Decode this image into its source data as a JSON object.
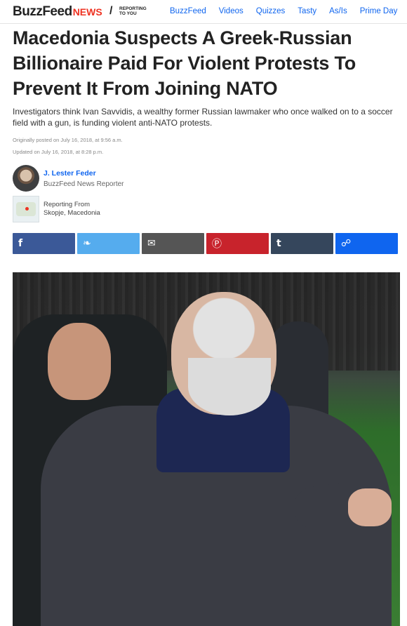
{
  "nav": {
    "logo_main": "BuzzFeed",
    "logo_news": "NEWS",
    "logo_reporting_line1": "REPORTING",
    "logo_reporting_line2": "TO YOU",
    "links": [
      "BuzzFeed",
      "Videos",
      "Quizzes",
      "Tasty",
      "As/Is",
      "Prime Day"
    ]
  },
  "article": {
    "headline": "Macedonia Suspects A Greek-Russian Billionaire Paid For Violent Protests To Prevent It From Joining NATO",
    "dek": "Investigators think Ivan Savvidis, a wealthy former Russian lawmaker who once walked on to a soccer field with a gun, is funding violent anti-NATO protests.",
    "posted": "Originally posted on July 16, 2018, at 9:56 a.m.",
    "updated": "Updated on July 16, 2018, at 8:28 p.m."
  },
  "byline": {
    "author_name": "J. Lester Feder",
    "author_role": "BuzzFeed News Reporter",
    "location_label": "Reporting From",
    "location_value": "Skopje, Macedonia"
  },
  "share": {
    "buttons": [
      {
        "name": "facebook",
        "icon": "facebook-icon",
        "glyph": "f",
        "color": "#3b5998"
      },
      {
        "name": "twitter",
        "icon": "twitter-icon",
        "glyph": "❧",
        "color": "#55acee"
      },
      {
        "name": "email",
        "icon": "email-icon",
        "glyph": "✉",
        "color": "#555555"
      },
      {
        "name": "pinterest",
        "icon": "pinterest-icon",
        "glyph": "Ⓟ",
        "color": "#c8232c"
      },
      {
        "name": "tumblr",
        "icon": "tumblr-icon",
        "glyph": "t",
        "color": "#35465c"
      },
      {
        "name": "link",
        "icon": "link-icon",
        "glyph": "☍",
        "color": "#0f65ef"
      }
    ]
  }
}
